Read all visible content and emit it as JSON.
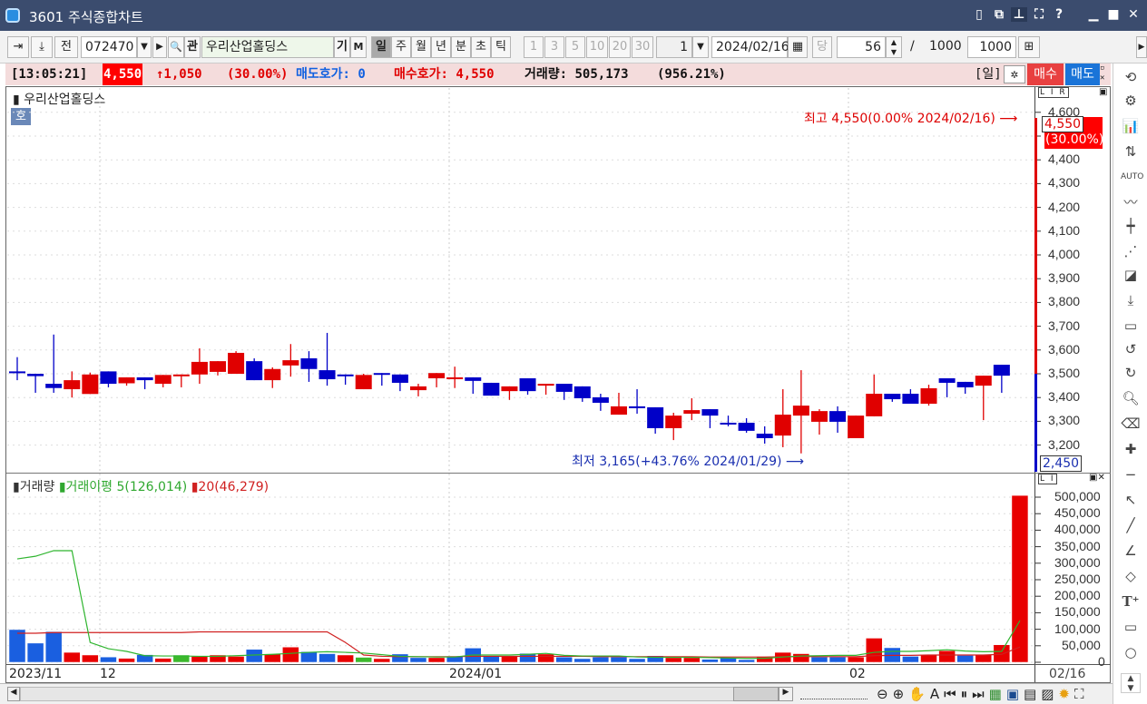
{
  "window": {
    "title": "3601 주식종합차트",
    "icons": [
      "info-icon",
      "copy-icon",
      "pin-icon",
      "fullscreen-icon",
      "help-icon",
      "minimize-icon",
      "maximize-icon",
      "close-icon"
    ],
    "help": "?"
  },
  "toolbar": {
    "code": "072470",
    "name": "우리산업홀딩스",
    "jeon": "전",
    "gwan": "관",
    "gi": "기",
    "m": "M",
    "periods": [
      "일",
      "주",
      "월",
      "년",
      "분",
      "초",
      "틱"
    ],
    "active_period": "일",
    "intervals": [
      "1",
      "3",
      "5",
      "10",
      "20",
      "30"
    ],
    "interval_value": "1",
    "date": "2024/02/16",
    "dang": "당",
    "count": "56",
    "slash": "/",
    "total": "1000",
    "display": "1000"
  },
  "info": {
    "time": "[13:05:21]",
    "price": "4,550",
    "change": "↑1,050",
    "change_pct": "(30.00%)",
    "ask_label": "매도호가: 0",
    "bid_label": "매수호가: 4,550",
    "volume_label": "거래량: 505,173",
    "volume_pct": "(956.21%)",
    "period": "[일]",
    "buy": "매수",
    "sell": "매도"
  },
  "price_panel": {
    "title": "우리산업홀딩스",
    "badge": "호",
    "lir": "L I R",
    "high_note": "최고 4,550(0.00% 2024/02/16)",
    "low_note": "최저 3,165(+43.76% 2024/01/29)",
    "cur_price": "4,550",
    "cur_pct": "(30.00%)",
    "base_price": "2,450"
  },
  "volume_panel": {
    "title": "거래량",
    "ma5_label": "거래이평 5(126,014)",
    "ma20_label": "20(46,279)",
    "lir": "L I"
  },
  "xaxis": {
    "labels": [
      "2023/11",
      "12",
      "2024/01",
      "02"
    ],
    "last": "02/16"
  },
  "colors": {
    "up": "#e00000",
    "down": "#0000c8",
    "vol_red": "#e80000",
    "vol_blue": "#1a5fe0",
    "vol_green": "#3cb82c",
    "ma5": "#2fb52f",
    "ma20": "#d02020"
  },
  "chart_data": [
    {
      "type": "candlestick",
      "title": "우리산업홀딩스",
      "ylim": [
        3100,
        4650
      ],
      "yticks": [
        "3,200",
        "3,300",
        "3,400",
        "3,500",
        "3,600",
        "3,700",
        "3,800",
        "3,900",
        "4,000",
        "4,100",
        "4,200",
        "4,300",
        "4,400",
        "4,500",
        "4,600"
      ],
      "ohlc": [
        [
          3510,
          3570,
          3473,
          3505
        ],
        [
          3500,
          3500,
          3420,
          3490
        ],
        [
          3458,
          3665,
          3420,
          3440
        ],
        [
          3435,
          3510,
          3400,
          3473
        ],
        [
          3415,
          3505,
          3415,
          3497
        ],
        [
          3510,
          3510,
          3443,
          3458
        ],
        [
          3460,
          3485,
          3450,
          3485
        ],
        [
          3485,
          3485,
          3435,
          3473
        ],
        [
          3458,
          3495,
          3443,
          3495
        ],
        [
          3493,
          3497,
          3443,
          3497
        ],
        [
          3497,
          3607,
          3458,
          3550
        ],
        [
          3508,
          3553,
          3493,
          3553
        ],
        [
          3500,
          3595,
          3500,
          3588
        ],
        [
          3553,
          3565,
          3473,
          3473
        ],
        [
          3473,
          3527,
          3440,
          3520
        ],
        [
          3535,
          3625,
          3488,
          3557
        ],
        [
          3565,
          3595,
          3466,
          3520
        ],
        [
          3515,
          3672,
          3450,
          3477
        ],
        [
          3497,
          3497,
          3454,
          3490
        ],
        [
          3435,
          3500,
          3435,
          3495
        ],
        [
          3503,
          3503,
          3450,
          3497
        ],
        [
          3497,
          3497,
          3427,
          3462
        ],
        [
          3431,
          3458,
          3405,
          3447
        ],
        [
          3481,
          3503,
          3443,
          3503
        ],
        [
          3481,
          3530,
          3440,
          3485
        ],
        [
          3485,
          3485,
          3416,
          3470
        ],
        [
          3462,
          3462,
          3408,
          3408
        ],
        [
          3427,
          3447,
          3390,
          3447
        ],
        [
          3481,
          3481,
          3412,
          3427
        ],
        [
          3450,
          3458,
          3412,
          3458
        ],
        [
          3458,
          3458,
          3390,
          3424
        ],
        [
          3447,
          3447,
          3382,
          3397
        ],
        [
          3401,
          3416,
          3344,
          3378
        ],
        [
          3328,
          3420,
          3328,
          3363
        ],
        [
          3363,
          3435,
          3332,
          3355
        ],
        [
          3359,
          3359,
          3248,
          3271
        ],
        [
          3271,
          3336,
          3221,
          3324
        ],
        [
          3332,
          3397,
          3305,
          3347
        ],
        [
          3351,
          3351,
          3271,
          3324
        ],
        [
          3294,
          3324,
          3279,
          3290
        ],
        [
          3294,
          3313,
          3252,
          3260
        ],
        [
          3248,
          3279,
          3206,
          3229
        ],
        [
          3240,
          3435,
          3191,
          3328
        ],
        [
          3324,
          3515,
          3165,
          3366
        ],
        [
          3298,
          3351,
          3244,
          3343
        ],
        [
          3343,
          3363,
          3252,
          3298
        ],
        [
          3229,
          3324,
          3229,
          3324
        ],
        [
          3321,
          3497,
          3321,
          3416
        ],
        [
          3416,
          3416,
          3382,
          3393
        ],
        [
          3416,
          3435,
          3374,
          3374
        ],
        [
          3374,
          3454,
          3366,
          3439
        ],
        [
          3481,
          3481,
          3401,
          3462
        ],
        [
          3466,
          3466,
          3416,
          3443
        ],
        [
          3450,
          3492,
          3305,
          3492
        ],
        [
          3538,
          3538,
          3420,
          3492
        ]
      ]
    },
    {
      "type": "bar",
      "title": "거래량",
      "ylim": [
        0,
        520000
      ],
      "yticks": [
        "0",
        "50,000",
        "100,000",
        "150,000",
        "200,000",
        "250,000",
        "300,000",
        "350,000",
        "400,000",
        "450,000",
        "500,000"
      ],
      "volume": [
        99000,
        58000,
        93000,
        30000,
        22000,
        16000,
        12000,
        23000,
        12000,
        22000,
        18000,
        22000,
        18000,
        39000,
        25000,
        46000,
        32000,
        26000,
        22000,
        15000,
        11000,
        25000,
        14000,
        14000,
        18000,
        43000,
        20000,
        18000,
        27000,
        25000,
        16000,
        11000,
        16000,
        16000,
        11000,
        20000,
        14000,
        14000,
        9000,
        14000,
        8000,
        16000,
        30000,
        26000,
        16000,
        16000,
        16000,
        73000,
        44000,
        18000,
        23000,
        35000,
        21000,
        23000,
        53000,
        505173
      ],
      "bar_colors": "bbbrrbrbrgrrrbrrbbrgrbbrbbbrbrbbbbbbrrbbbrrrbbrrbbrrbrrr",
      "ma5": [
        313000,
        321000,
        338000,
        338000,
        60000,
        41000,
        33000,
        20000,
        19000,
        19000,
        18000,
        18000,
        20000,
        22000,
        24000,
        27000,
        30000,
        32000,
        30000,
        28000,
        23000,
        18000,
        17000,
        16000,
        16000,
        22000,
        22000,
        22000,
        24000,
        27000,
        21000,
        19000,
        19000,
        19000,
        16000,
        15000,
        15000,
        15000,
        14000,
        13000,
        12000,
        12000,
        16000,
        19000,
        20000,
        21000,
        21000,
        30000,
        33000,
        33000,
        35000,
        38000,
        34000,
        32000,
        33000,
        126014
      ],
      "ma20": [
        88000,
        88000,
        90000,
        90000,
        90000,
        90000,
        90000,
        90000,
        90000,
        90000,
        92000,
        92000,
        92000,
        92000,
        92000,
        92000,
        92000,
        92000,
        60000,
        22000,
        18000,
        17000,
        17000,
        17000,
        17000,
        18000,
        18000,
        18000,
        18000,
        18000,
        18000,
        18000,
        17000,
        17000,
        17000,
        17000,
        17000,
        17000,
        16000,
        16000,
        16000,
        16000,
        17000,
        17000,
        17000,
        17000,
        17000,
        20000,
        21000,
        21000,
        22000,
        22000,
        22000,
        22000,
        24000,
        46279
      ]
    }
  ]
}
